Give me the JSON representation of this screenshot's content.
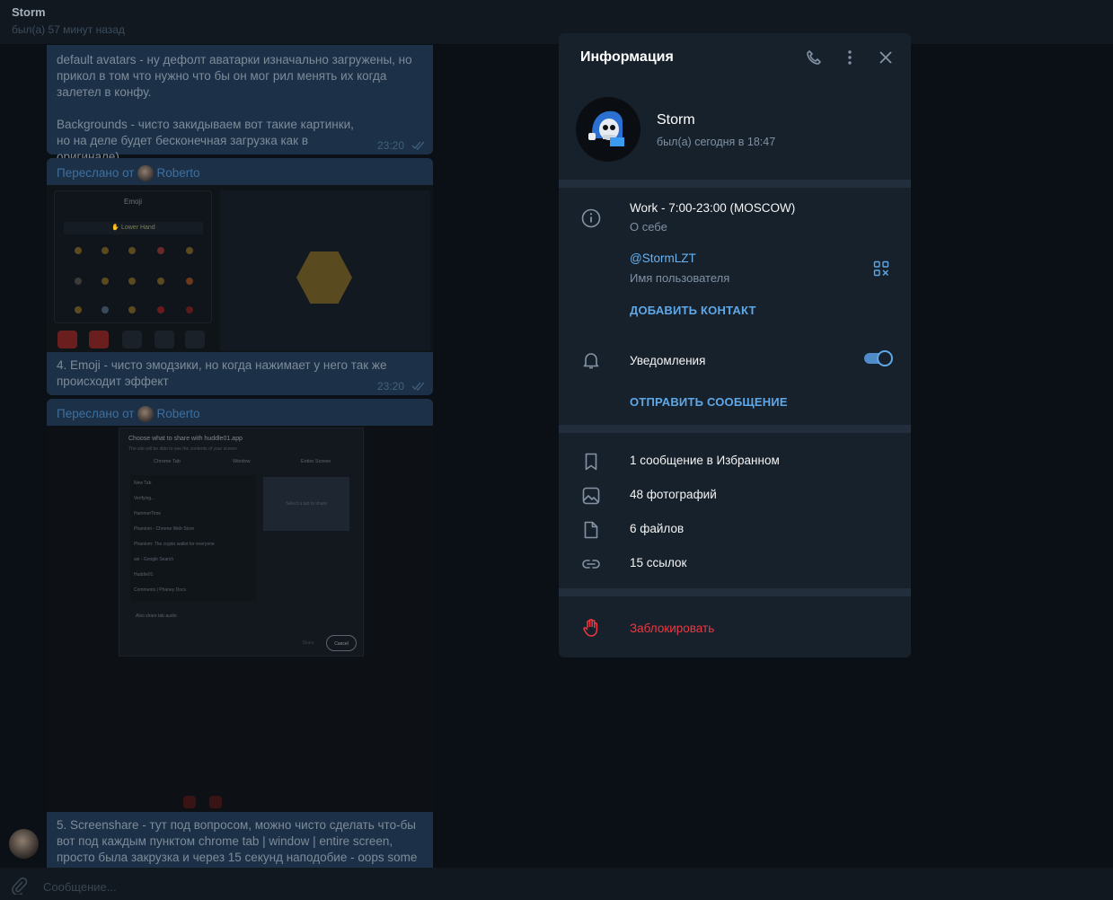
{
  "header": {
    "name": "Storm",
    "status": "был(а) 57 минут назад"
  },
  "messages": {
    "m1_text_a": "default avatars - ну дефолт аватарки изначально загружены, но прикол в том что нужно что бы он мог рил менять их когда залетел в конфу.",
    "m1_text_b": "Backgrounds - чисто закидываем вот такие картинки, но на деле будет бесконечная загрузка как в оригинале)",
    "m1_time": "23:20",
    "forward_prefix": "Переслано от",
    "forward_name": "Roberto",
    "m2_text": "4. Emoji - чисто эмодзики, но когда нажимает у него так же происходит эффект",
    "m2_time": "23:20",
    "m3_text": "5. Screenshare - тут под вопросом, можно чисто сделать что-бы вот под каждым пунктом chrome tab | window | entire screen, просто была закрузка и через 15 секунд наподобие - oops some"
  },
  "shot1": {
    "panel_title": "Emoji",
    "lower_hand": "✋ Lower Hand"
  },
  "shot2": {
    "title": "Choose what to share with huddle01.app",
    "subtitle": "The site will be able to see the contents of your screen",
    "tabs": [
      "Chrome Tab",
      "Window",
      "Entire Screen"
    ],
    "items": [
      "New Tab",
      "Verifying...",
      "HammerTime",
      "Phantom - Chrome Web Store",
      "Phantom: The crypto wallet for everyone",
      "asi - Google Search",
      "Huddle01",
      "Comments | Phaney Docs"
    ],
    "preview": "Select a tab to share",
    "audio": "Also share tab audio",
    "share": "Share",
    "cancel": "Cancel"
  },
  "input": {
    "placeholder": "Сообщение..."
  },
  "panel": {
    "title": "Информация",
    "name": "Storm",
    "status": "был(а) сегодня в 18:47",
    "bio": "Work - 7:00-23:00 (MOSCOW)",
    "bio_label": "О себе",
    "username": "@StormLZT",
    "username_label": "Имя пользователя",
    "add_contact": "ДОБАВИТЬ КОНТАКТ",
    "notifications": "Уведомления",
    "notifications_on": true,
    "send_message": "ОТПРАВИТЬ СООБЩЕНИЕ",
    "saved": "1 сообщение в Избранном",
    "photos": "48 фотографий",
    "files": "6 файлов",
    "links": "15 ссылок",
    "block": "Заблокировать"
  },
  "colors": {
    "accent": "#5fa8e8",
    "danger": "#ec3942",
    "panel_bg": "#17212b",
    "bubble_bg": "#1c3148"
  },
  "icons": [
    "phone-icon",
    "more-vertical-icon",
    "close-icon",
    "info-icon",
    "qr-code-icon",
    "bell-icon",
    "bookmark-icon",
    "photo-icon",
    "file-icon",
    "link-icon",
    "hand-block-icon",
    "attach-icon"
  ]
}
